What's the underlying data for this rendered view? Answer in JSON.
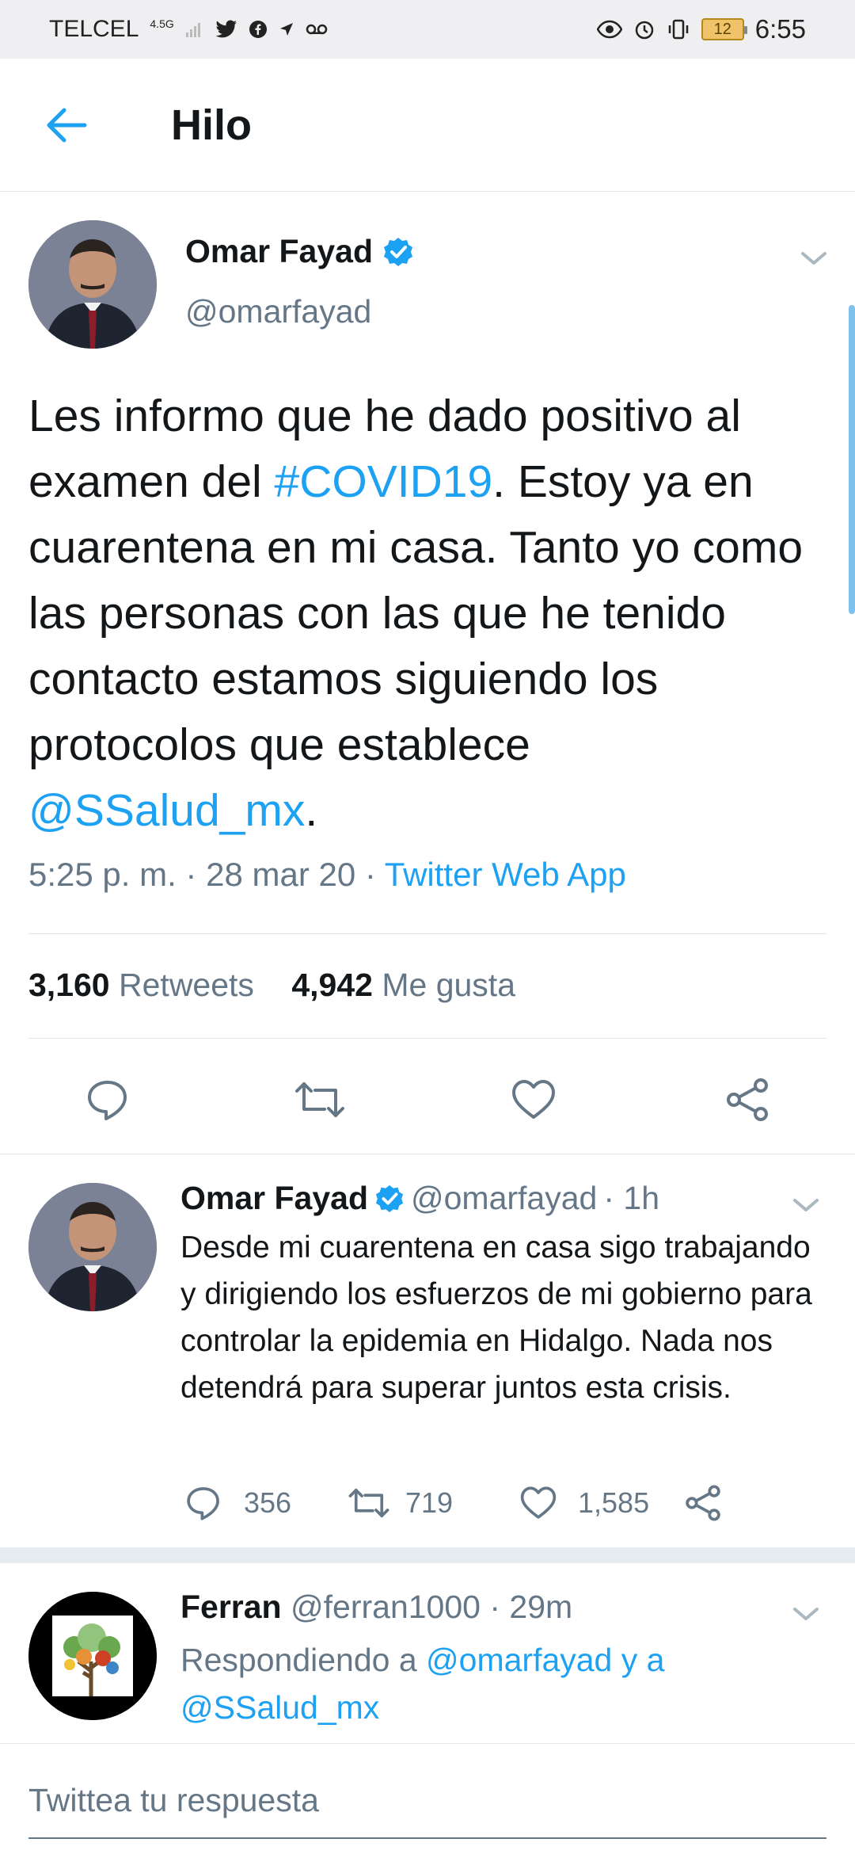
{
  "status_bar": {
    "carrier": "TELCEL",
    "network": "4.5G",
    "battery": "12",
    "time": "6:55"
  },
  "header": {
    "back_icon": "arrow-left-icon",
    "title": "Hilo"
  },
  "main_tweet": {
    "name": "Omar Fayad",
    "handle": "@omarfayad",
    "text_before_hashtag": "Les informo que he dado positivo al examen del ",
    "hashtag": "#COVID19",
    "text_middle": ". Estoy ya en cuarentena en mi casa. Tanto yo como las personas con las que he tenido contacto estamos siguiendo los protocolos que establece ",
    "mention": "@SSalud_mx",
    "text_end": ".",
    "time": "5:25 p. m. · 28 mar 20 · ",
    "source": "Twitter Web App",
    "retweets_count": "3,160",
    "retweets_label": "Retweets",
    "likes_count": "4,942",
    "likes_label": "Me gusta"
  },
  "reply_1": {
    "name": "Omar Fayad",
    "handle": "@omarfayad",
    "age": "· 1h",
    "text": "Desde mi cuarentena en casa sigo trabajando y dirigiendo los esfuerzos de mi gobierno para controlar la epidemia en Hidalgo. Nada nos detendrá para superar juntos esta crisis.",
    "replies": "356",
    "retweets": "719",
    "likes": "1,585"
  },
  "reply_2": {
    "name": "Ferran",
    "handle": "@ferran1000",
    "age": "· 29m",
    "replying_prefix": "Respondiendo a ",
    "replying_to_1": "@omarfayad",
    "replying_join": " y a",
    "replying_to_2": "@SSalud_mx"
  },
  "compose": {
    "placeholder": "Twittea tu respuesta"
  },
  "colors": {
    "accent": "#1da1f2",
    "muted": "#657786",
    "text": "#14171a"
  }
}
